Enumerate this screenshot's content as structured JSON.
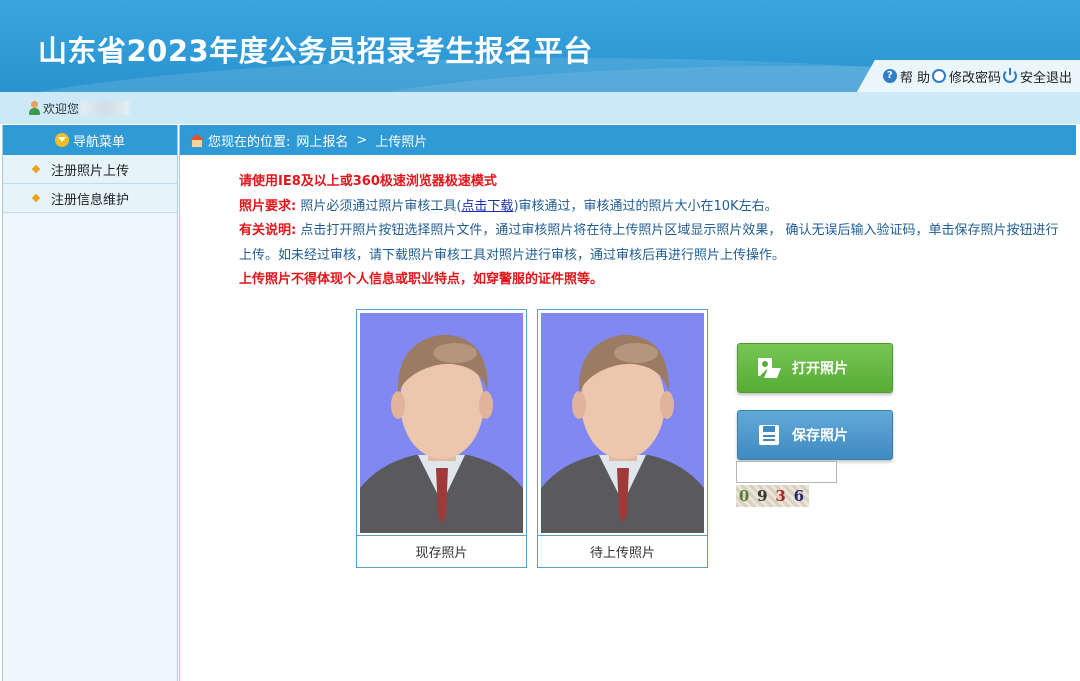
{
  "header": {
    "title": "山东省2023年度公务员招录考生报名平台",
    "tools": [
      {
        "label": "帮 助",
        "icon": "help-icon"
      },
      {
        "label": "修改密码",
        "icon": "key-icon"
      },
      {
        "label": "安全退出",
        "icon": "power-icon"
      }
    ]
  },
  "welcome": {
    "label": "欢迎您"
  },
  "sidebar": {
    "title": "导航菜单",
    "items": [
      {
        "label": "注册照片上传"
      },
      {
        "label": "注册信息维护"
      }
    ]
  },
  "breadcrumb": {
    "prefix": "您现在的位置:",
    "items": [
      "网上报名",
      "上传照片"
    ],
    "separator": ">"
  },
  "notes": {
    "browser": "请使用IE8及以上或360极速浏览器极速模式",
    "req_label": "照片要求:",
    "req_text_1": "照片必须通过照片审核工具(",
    "req_link": "点击下载",
    "req_text_2": ")审核通过，审核通过的照片大小在10K左右。",
    "desc_label": "有关说明:",
    "desc_text": "点击打开照片按钮选择照片文件，通过审核照片将在待上传照片区域显示照片效果， 确认无误后输入验证码，单击保存照片按钮进行上传。如未经过审核，请下载照片审核工具对照片进行审核，通过审核后再进行照片上传操作。",
    "warning": "上传照片不得体现个人信息或职业特点，如穿警服的证件照等。"
  },
  "photos": {
    "current_caption": "现存照片",
    "pending_caption": "待上传照片"
  },
  "buttons": {
    "open_label": "打开照片",
    "save_label": "保存照片"
  },
  "captcha": {
    "value": "",
    "code": [
      "0",
      "9",
      "3",
      "6"
    ],
    "colors": [
      "#5a7a3a",
      "#333333",
      "#b02020",
      "#2a2a6a"
    ]
  },
  "colors": {
    "accent": "#2f9ad6",
    "warning": "#e4141b",
    "open_button": "#56ad35",
    "save_button": "#3f8ac1"
  }
}
